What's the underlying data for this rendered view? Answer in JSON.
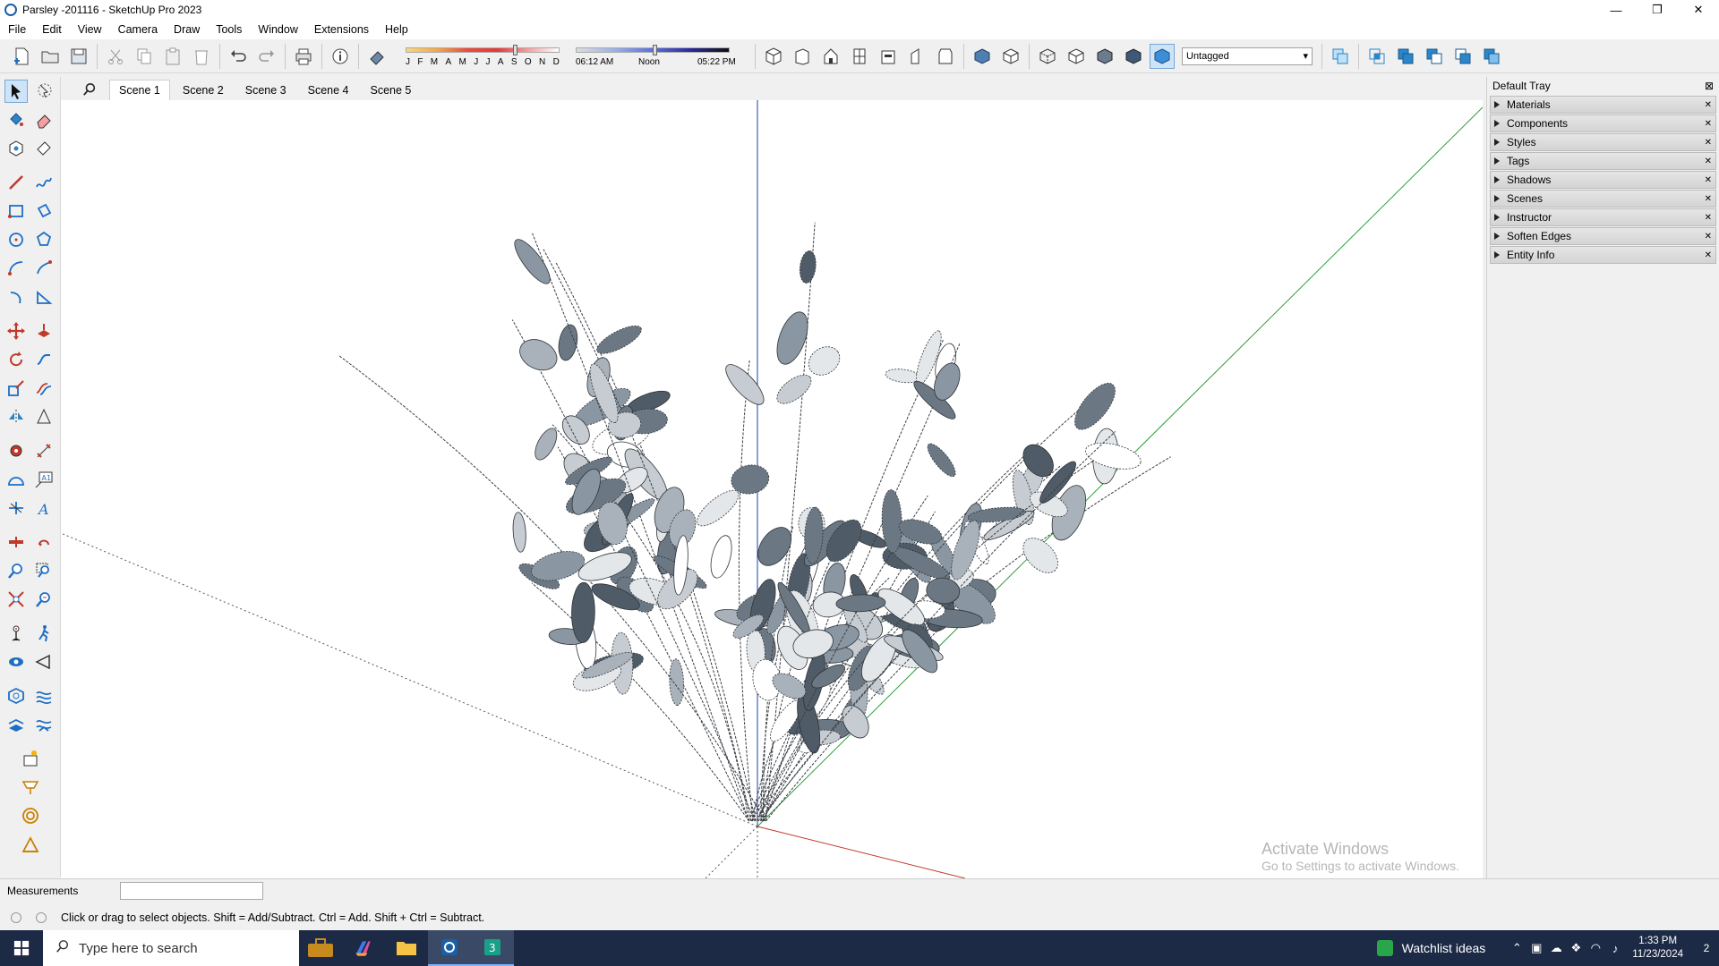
{
  "window": {
    "title": "Parsley -201116 - SketchUp Pro 2023",
    "controls": [
      "—",
      "❐",
      "✕"
    ]
  },
  "menu": [
    "File",
    "Edit",
    "View",
    "Camera",
    "Draw",
    "Tools",
    "Window",
    "Extensions",
    "Help"
  ],
  "toolbar": {
    "shadow": {
      "months": [
        "J",
        "F",
        "M",
        "A",
        "M",
        "J",
        "J",
        "A",
        "S",
        "O",
        "N",
        "D"
      ],
      "time_start": "06:12 AM",
      "time_mid": "Noon",
      "time_end": "05:22 PM"
    },
    "tag_select": "Untagged"
  },
  "scenes": {
    "tabs": [
      "Scene 1",
      "Scene 2",
      "Scene 3",
      "Scene 4",
      "Scene 5"
    ],
    "active": "Scene 1"
  },
  "tray": {
    "title": "Default Tray",
    "panels": [
      "Materials",
      "Components",
      "Styles",
      "Tags",
      "Shadows",
      "Scenes",
      "Instructor",
      "Soften Edges",
      "Entity Info"
    ]
  },
  "watermark": {
    "line1": "Activate Windows",
    "line2": "Go to Settings to activate Windows."
  },
  "measurements": {
    "label": "Measurements",
    "value": ""
  },
  "status": {
    "text": "Click or drag to select objects. Shift = Add/Subtract. Ctrl = Add. Shift + Ctrl = Subtract."
  },
  "taskbar": {
    "search_placeholder": "Type here to search",
    "watchlist": "Watchlist ideas",
    "time": "1:33 PM",
    "date": "11/23/2024",
    "notifications": "2"
  },
  "colors": {
    "axis_red": "#c0392b",
    "axis_green": "#2e9e3a",
    "axis_blue": "#1a3fb0",
    "taskbar": "#1c2a45"
  }
}
